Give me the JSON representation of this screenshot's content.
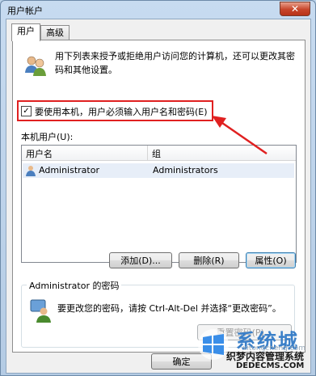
{
  "window": {
    "title": "用户帐户",
    "close_glyph": "✕"
  },
  "tabs": [
    {
      "label": "用户",
      "active": true
    },
    {
      "label": "高级",
      "active": false
    }
  ],
  "description": "用下列表来授予或拒绝用户访问您的计算机，还可以更改其密码和其他设置。",
  "checkbox": {
    "label": "要使用本机，用户必须输入用户名和密码(E)",
    "checked": true,
    "check_glyph": "✓"
  },
  "local_users": {
    "label": "本机用户(U):",
    "columns": [
      "用户名",
      "组"
    ],
    "rows": [
      {
        "name": "Administrator",
        "group": "Administrators"
      }
    ]
  },
  "buttons": {
    "add": "添加(D)...",
    "remove": "删除(R)",
    "properties": "属性(O)"
  },
  "password_group": {
    "title": "Administrator 的密码",
    "text": "要更改您的密码，请按 Ctrl-Alt-Del 并选择“更改密码”。",
    "reset_button": "重置密码(P)..."
  },
  "ok_button": "确定",
  "watermark": {
    "brand": "系统城",
    "line": "织梦内容管理系统",
    "site": "DEDECMS.COM",
    "faint": "xitongcheng.com"
  },
  "colors": {
    "highlight_red": "#e02020",
    "accent_blue": "#3a7fc8"
  }
}
